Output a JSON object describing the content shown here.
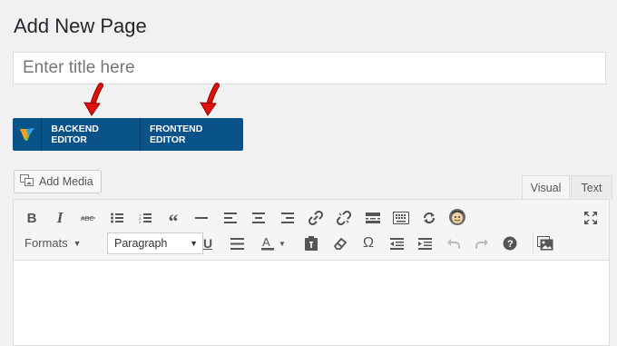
{
  "page": {
    "title": "Add New Page"
  },
  "title_field": {
    "placeholder": "Enter title here"
  },
  "composer": {
    "backend_label": "BACKEND EDITOR",
    "frontend_label": "FRONTEND EDITOR"
  },
  "media": {
    "add_label": "Add Media"
  },
  "editor_tabs": {
    "visual": "Visual",
    "text": "Text"
  },
  "toolbar": {
    "row1": [
      "bold-icon",
      "italic-icon",
      "strikethrough-icon",
      "bulleted-list-icon",
      "numbered-list-icon",
      "blockquote-icon",
      "horizontal-line-icon",
      "align-left-icon",
      "align-center-icon",
      "align-right-icon",
      "insert-link-icon",
      "remove-link-icon",
      "read-more-icon",
      "toolbar-toggle-icon",
      "sync-icon",
      "mailchimp-icon",
      "fullscreen-icon"
    ],
    "formats_label": "Formats",
    "paragraph_value": "Paragraph",
    "row2": [
      "underline-icon",
      "justify-icon",
      "text-color-icon",
      "paste-as-text-icon",
      "clear-formatting-icon",
      "special-character-icon",
      "outdent-icon",
      "indent-icon",
      "undo-icon",
      "redo-icon",
      "help-icon",
      "insert-gallery-icon"
    ]
  },
  "colors": {
    "composer_bar": "#0a5389",
    "arrow": "#e0100c",
    "accent_text": "#23282d"
  }
}
